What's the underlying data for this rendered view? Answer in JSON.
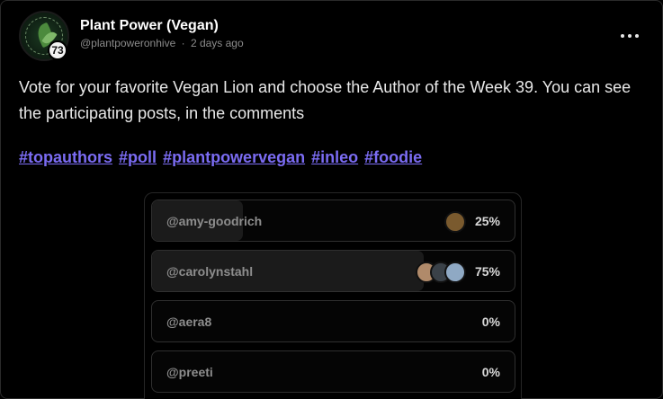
{
  "author": {
    "name": "Plant Power (Vegan)",
    "handle": "@plantpoweronhive",
    "separator": "·",
    "time": "2 days ago",
    "reputation": "73",
    "avatar_icon": "plant-leaf-logo"
  },
  "menu": {
    "icon": "more-horizontal-icon"
  },
  "post": {
    "text": "Vote for your favorite Vegan Lion and choose the Author of the Week 39. You can see the participating posts, in the comments",
    "tags": [
      "#topauthors",
      "#poll",
      "#plantpowervegan",
      "#inleo",
      "#foodie"
    ]
  },
  "poll": {
    "options": [
      {
        "label": "@amy-goodrich",
        "percent": "25%",
        "fill": 25,
        "voters": [
          "#7a5a2e"
        ]
      },
      {
        "label": "@carolynstahl",
        "percent": "75%",
        "fill": 75,
        "voters": [
          "#b08a6a",
          "#3a4148",
          "#8fa9c4"
        ]
      },
      {
        "label": "@aera8",
        "percent": "0%",
        "fill": 0,
        "voters": []
      },
      {
        "label": "@preeti",
        "percent": "0%",
        "fill": 0,
        "voters": []
      }
    ]
  },
  "colors": {
    "background": "#000000",
    "tag": "#7b6cf3",
    "poll_fill": "#1b1b1b",
    "text": "#e9e9e9"
  }
}
